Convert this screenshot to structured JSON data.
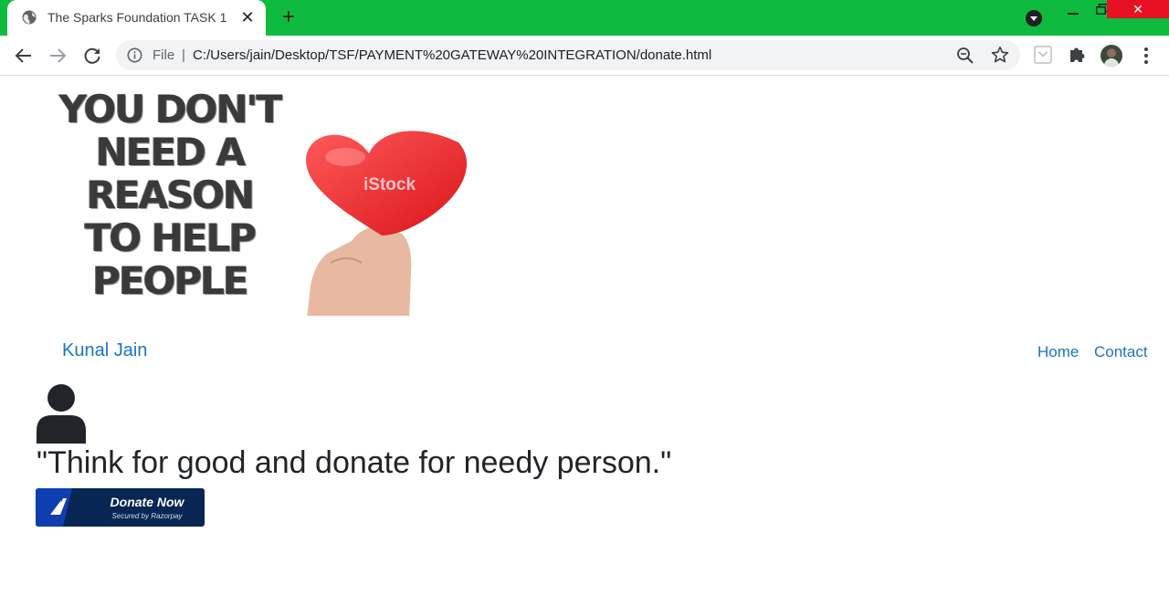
{
  "browser": {
    "tab_title": "The Sparks Foundation TASK 1",
    "tab_close": "✕",
    "new_tab": "+",
    "window_close": "✕",
    "url_scheme": "File",
    "url_separator": "|",
    "url": "C:/Users/jain/Desktop/TSF/PAYMENT%20GATEWAY%20INTEGRATION/donate.html",
    "titlebar_color": "#0ebb3e"
  },
  "page": {
    "banner": {
      "lines": [
        "YOU DON'T",
        "NEED A",
        "REASON",
        "TO HELP",
        "PEOPLE"
      ],
      "watermark": "iStock"
    },
    "navbar": {
      "brand": "Kunal Jain",
      "links": [
        "Home",
        "Contact"
      ],
      "link_color": "#1a73c8"
    },
    "user_icon": "user-icon",
    "quote": "\"Think for good and donate for needy person.\"",
    "donate": {
      "label": "Donate Now",
      "sub_label": "Secured by Razorpay",
      "color": "#072654"
    }
  }
}
